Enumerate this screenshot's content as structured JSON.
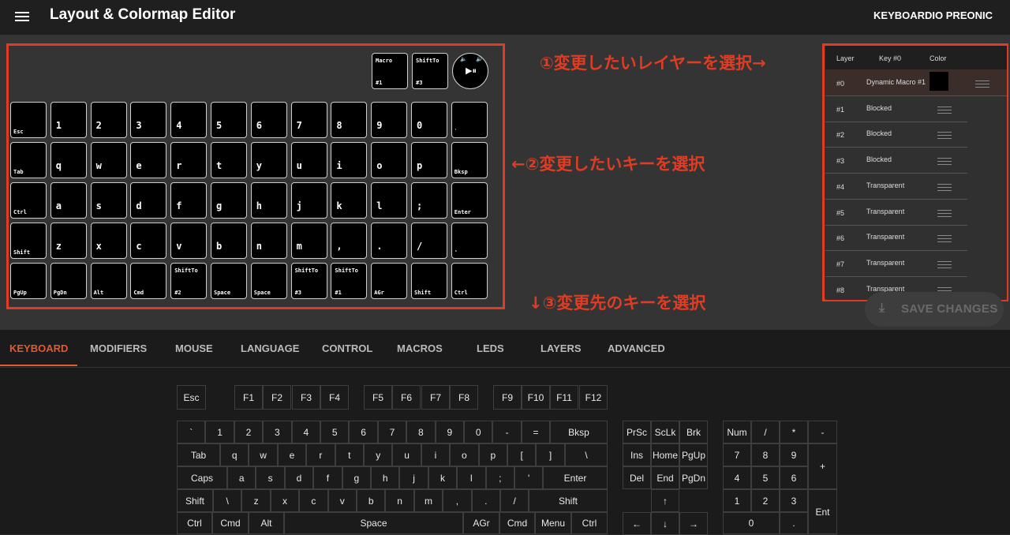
{
  "app": {
    "title": "Layout & Colormap Editor",
    "device": "KEYBOARDIO PREONIC"
  },
  "annotations": {
    "step1": "①変更したいレイヤーを選択→",
    "step2": "←②変更したいキーを選択",
    "step3": "↓③変更先のキーを選択"
  },
  "keyboard_top": [
    {
      "t": "Macro",
      "b": "#1"
    },
    {
      "t": "ShiftTo",
      "b": "#3"
    }
  ],
  "knob": {
    "glyph": "▶⏸",
    "left_glyph": "🔈",
    "right_glyph": "🔊"
  },
  "keyboard_rows": [
    [
      "Esc",
      "1",
      "2",
      "3",
      "4",
      "5",
      "6",
      "7",
      "8",
      "9",
      "0",
      "`"
    ],
    [
      "Tab",
      "q",
      "w",
      "e",
      "r",
      "t",
      "y",
      "u",
      "i",
      "o",
      "p",
      "Bksp"
    ],
    [
      "Ctrl",
      "a",
      "s",
      "d",
      "f",
      "g",
      "h",
      "j",
      "k",
      "l",
      ";",
      "Enter"
    ],
    [
      "Shift",
      "z",
      "x",
      "c",
      "v",
      "b",
      "n",
      "m",
      ",",
      ".",
      "/",
      "'"
    ],
    [
      "PgUp",
      "PgDn",
      "Alt",
      "Cmd",
      {
        "t": "ShiftTo",
        "b": "#2"
      },
      "Space",
      "Space",
      {
        "t": "ShiftTo",
        "b": "#3"
      },
      {
        "t": "ShiftTo",
        "b": "#1"
      },
      "AGr",
      "Shift",
      "Ctrl"
    ]
  ],
  "layers": {
    "headers": {
      "layer": "Layer",
      "key": "Key #0",
      "color": "Color"
    },
    "rows": [
      {
        "num": "#0",
        "key": "Dynamic Macro #1",
        "active": true
      },
      {
        "num": "#1",
        "key": "Blocked"
      },
      {
        "num": "#2",
        "key": "Blocked"
      },
      {
        "num": "#3",
        "key": "Blocked"
      },
      {
        "num": "#4",
        "key": "Transparent"
      },
      {
        "num": "#5",
        "key": "Transparent"
      },
      {
        "num": "#6",
        "key": "Transparent"
      },
      {
        "num": "#7",
        "key": "Transparent"
      },
      {
        "num": "#8",
        "key": "Transparent"
      }
    ]
  },
  "save": {
    "label": "SAVE CHANGES",
    "icon": "download-icon"
  },
  "tabs": [
    "KEYBOARD",
    "MODIFIERS",
    "MOUSE",
    "LANGUAGE",
    "CONTROL",
    "MACROS",
    "LEDS",
    "LAYERS",
    "ADVANCED"
  ],
  "selector": {
    "fn": [
      "Esc",
      "F1",
      "F2",
      "F3",
      "F4",
      "F5",
      "F6",
      "F7",
      "F8",
      "F9",
      "F10",
      "F11",
      "F12"
    ],
    "row1": [
      "`",
      "1",
      "2",
      "3",
      "4",
      "5",
      "6",
      "7",
      "8",
      "9",
      "0",
      "-",
      "=",
      "Bksp"
    ],
    "row2": [
      "Tab",
      "q",
      "w",
      "e",
      "r",
      "t",
      "y",
      "u",
      "i",
      "o",
      "p",
      "[",
      "]",
      "\\"
    ],
    "row3": [
      "Caps",
      "a",
      "s",
      "d",
      "f",
      "g",
      "h",
      "j",
      "k",
      "l",
      ";",
      "'",
      "Enter"
    ],
    "row4": [
      "Shift",
      "\\",
      "z",
      "x",
      "c",
      "v",
      "b",
      "n",
      "m",
      ",",
      ".",
      "/",
      "Shift"
    ],
    "row5": [
      "Ctrl",
      "Cmd",
      "Alt",
      "Space",
      "AGr",
      "Cmd",
      "Menu",
      "Ctrl"
    ],
    "nav": [
      "PrSc",
      "ScLk",
      "Brk",
      "Ins",
      "Home",
      "PgUp",
      "Del",
      "End",
      "PgDn",
      "↑",
      "←",
      "↓",
      "→"
    ],
    "numpad": [
      "Num",
      "/",
      "*",
      "-",
      "7",
      "8",
      "9",
      "+",
      "4",
      "5",
      "6",
      "1",
      "2",
      "3",
      "Ent",
      "0",
      "."
    ]
  },
  "colors": {
    "accent": "#e05a32",
    "annotation": "#e03c24"
  }
}
